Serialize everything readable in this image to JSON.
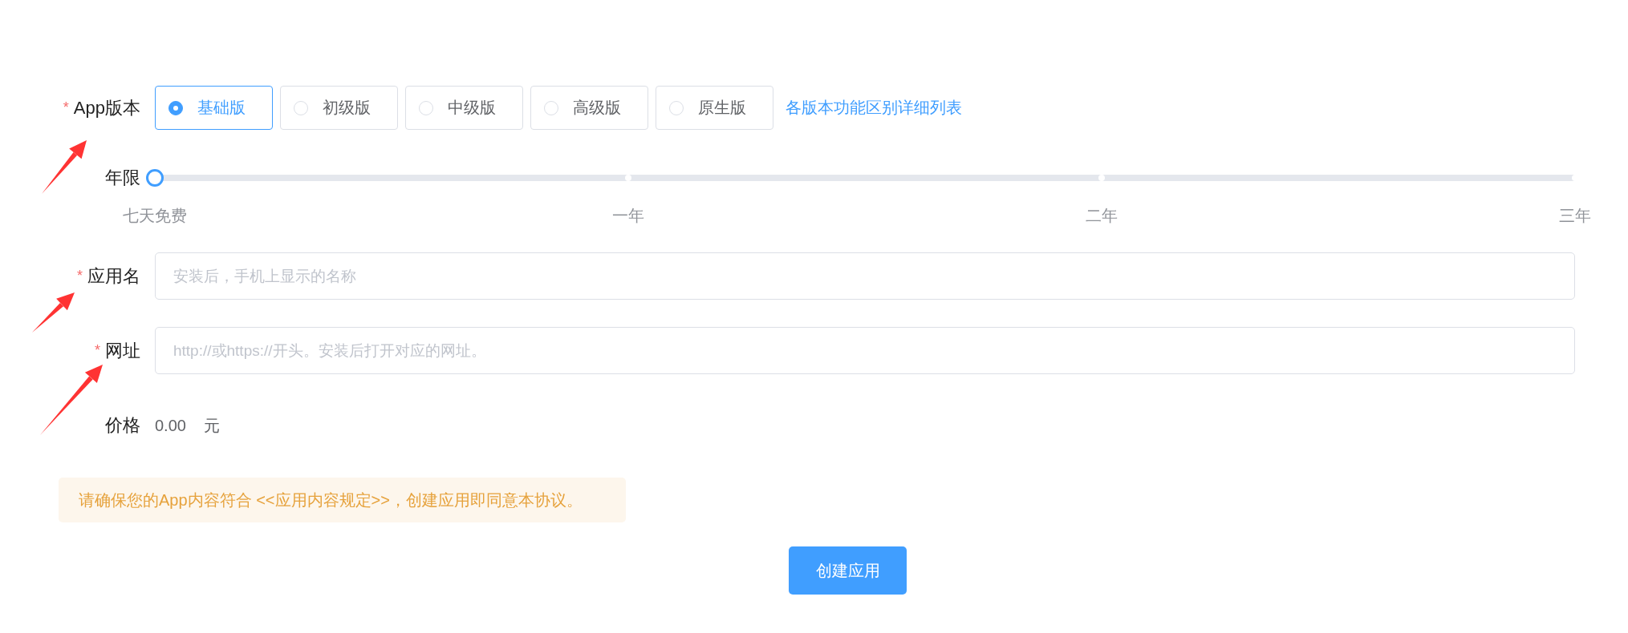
{
  "version": {
    "label": "App版本",
    "required_mark": "*",
    "options": [
      {
        "label": "基础版",
        "selected": true
      },
      {
        "label": "初级版",
        "selected": false
      },
      {
        "label": "中级版",
        "selected": false
      },
      {
        "label": "高级版",
        "selected": false
      },
      {
        "label": "原生版",
        "selected": false
      }
    ],
    "link": "各版本功能区别详细列表"
  },
  "term": {
    "label": "年限",
    "level": 0,
    "marks": [
      "七天免费",
      "一年",
      "二年",
      "三年"
    ]
  },
  "fields": [
    {
      "label": "应用名",
      "required_mark": "*",
      "placeholder": "安装后，手机上显示的名称"
    },
    {
      "label": "网址",
      "required_mark": "*",
      "placeholder": "http://或https://开头。安装后打开对应的网址。"
    }
  ],
  "price": {
    "label": "价格",
    "value": "0.00",
    "unit": "元"
  },
  "notice": "请确保您的App内容符合 <<应用内容规定>>，创建应用即同意本协议。",
  "submit": "创建应用"
}
